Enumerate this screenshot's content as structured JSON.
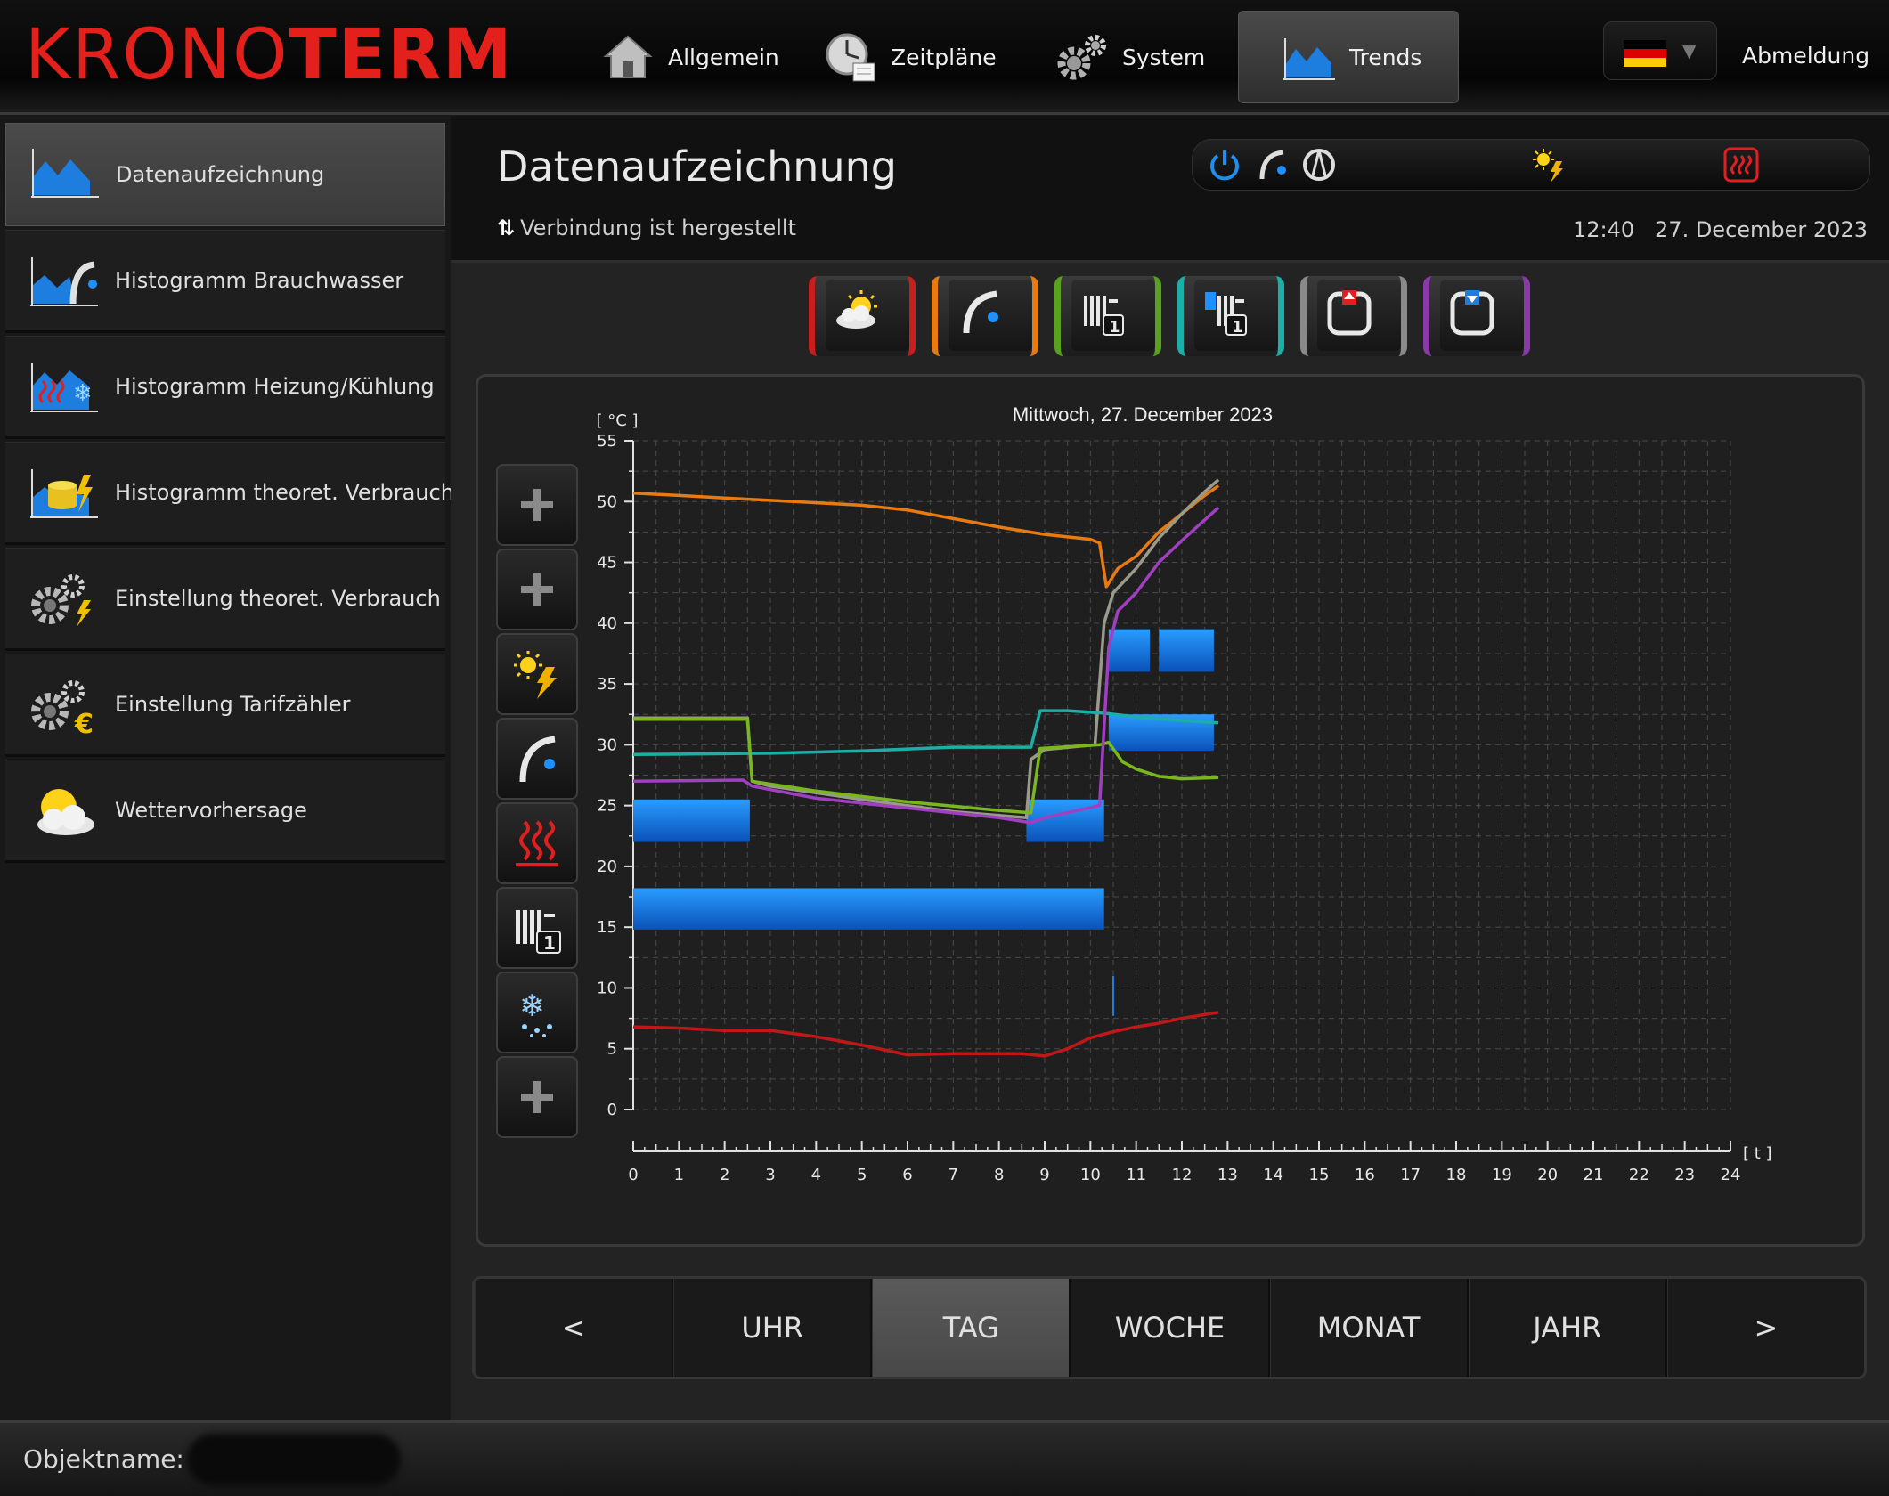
{
  "header": {
    "logo_thin": "KRONO",
    "logo_bold": "TERM",
    "nav": [
      {
        "label": "Allgemein",
        "icon": "home-icon"
      },
      {
        "label": "Zeitpläne",
        "icon": "clock-icon"
      },
      {
        "label": "System",
        "icon": "gears-icon"
      },
      {
        "label": "Trends",
        "icon": "trend-chart-icon"
      }
    ],
    "active_nav": "Trends",
    "language": "de",
    "logout_label": "Abmeldung"
  },
  "sidebar": {
    "items": [
      {
        "label": "Datenaufzeichnung",
        "icon": "area-chart-icon",
        "active": true
      },
      {
        "label": "Histogramm Brauchwasser",
        "icon": "dhw-histogram-icon"
      },
      {
        "label": "Histogramm Heizung/Kühlung",
        "icon": "heating-cooling-histogram-icon"
      },
      {
        "label": "Histogramm theoret. Verbrauch",
        "icon": "consumption-histogram-icon"
      },
      {
        "label": "Einstellung theoret. Verbrauch",
        "icon": "gear-lightning-icon"
      },
      {
        "label": "Einstellung Tarifzähler",
        "icon": "gear-euro-icon"
      },
      {
        "label": "Wettervorhersage",
        "icon": "weather-icon"
      }
    ]
  },
  "main": {
    "title": "Datenaufzeichnung",
    "connection_status": "Verbindung ist hergestellt",
    "time": "12:40",
    "date": "27. December 2023",
    "status_icons": [
      "power-icon",
      "tap-icon",
      "compressor-icon",
      "sun-lightning-icon",
      "heating-element-icon"
    ],
    "toolbar": [
      {
        "icon": "weather-icon",
        "color": "#c81e1e"
      },
      {
        "icon": "tap-icon",
        "color": "#e87a12"
      },
      {
        "icon": "radiator-1-icon",
        "color": "#5aa21e"
      },
      {
        "icon": "radiator-thermostat-1-icon",
        "color": "#1ab0a8"
      },
      {
        "icon": "storage-up-icon",
        "color": "#8a8a8a"
      },
      {
        "icon": "storage-down-icon",
        "color": "#8a3aa8"
      }
    ],
    "chart_side_buttons": [
      "plus-icon",
      "plus-icon",
      "sun-lightning-icon",
      "tap-icon",
      "heating-icon",
      "radiator-1-icon",
      "cooling-icon",
      "plus-icon"
    ],
    "periods": [
      {
        "label": "<"
      },
      {
        "label": "UHR"
      },
      {
        "label": "TAG",
        "active": true
      },
      {
        "label": "WOCHE"
      },
      {
        "label": "MONAT"
      },
      {
        "label": "JAHR"
      },
      {
        "label": ">"
      }
    ]
  },
  "footer": {
    "object_label": "Objektname:"
  },
  "chart_data": {
    "type": "line",
    "title": "Mittwoch, 27. December 2023",
    "ylabel": "[ °C ]",
    "xlabel": "[ t ]",
    "xlim": [
      0,
      24
    ],
    "ylim": [
      0,
      55
    ],
    "xticks": [
      0,
      1,
      2,
      3,
      4,
      5,
      6,
      7,
      8,
      9,
      10,
      11,
      12,
      13,
      14,
      15,
      16,
      17,
      18,
      19,
      20,
      21,
      22,
      23,
      24
    ],
    "yticks": [
      0,
      5,
      10,
      15,
      20,
      25,
      30,
      35,
      40,
      45,
      50,
      55
    ],
    "grid": true,
    "series": [
      {
        "color": "#e87a12",
        "points": [
          [
            0,
            50.7
          ],
          [
            1,
            50.5
          ],
          [
            2,
            50.3
          ],
          [
            3,
            50.1
          ],
          [
            4,
            49.9
          ],
          [
            5,
            49.7
          ],
          [
            6,
            49.3
          ],
          [
            7,
            48.6
          ],
          [
            8,
            47.9
          ],
          [
            9,
            47.3
          ],
          [
            10,
            46.9
          ],
          [
            10.2,
            46.6
          ],
          [
            10.35,
            43
          ],
          [
            10.6,
            44.5
          ],
          [
            11,
            45.5
          ],
          [
            11.5,
            47.5
          ],
          [
            12,
            49
          ],
          [
            12.5,
            50.5
          ],
          [
            12.8,
            51.3
          ]
        ]
      },
      {
        "color": "#9a9a8a",
        "points": [
          [
            0,
            32.2
          ],
          [
            2.5,
            32.2
          ],
          [
            2.6,
            27
          ],
          [
            3,
            26.6
          ],
          [
            5,
            25.5
          ],
          [
            7,
            24.5
          ],
          [
            8.6,
            24
          ],
          [
            8.7,
            28.8
          ],
          [
            9,
            29.6
          ],
          [
            10.1,
            30
          ],
          [
            10.3,
            40
          ],
          [
            10.5,
            42.5
          ],
          [
            11,
            44.5
          ],
          [
            11.5,
            47
          ],
          [
            12,
            49
          ],
          [
            12.5,
            50.8
          ],
          [
            12.8,
            51.8
          ]
        ]
      },
      {
        "color": "#1ab0a8",
        "points": [
          [
            0,
            29.2
          ],
          [
            3,
            29.3
          ],
          [
            5,
            29.5
          ],
          [
            7,
            29.8
          ],
          [
            8.7,
            29.8
          ],
          [
            8.9,
            32.8
          ],
          [
            9.5,
            32.8
          ],
          [
            10.3,
            32.6
          ],
          [
            11,
            32.3
          ],
          [
            12,
            32
          ],
          [
            12.8,
            31.8
          ]
        ]
      },
      {
        "color": "#7ab61e",
        "points": [
          [
            0,
            32.1
          ],
          [
            2.5,
            32.1
          ],
          [
            2.6,
            27
          ],
          [
            4,
            26.2
          ],
          [
            6,
            25.3
          ],
          [
            8,
            24.6
          ],
          [
            8.7,
            24.4
          ],
          [
            8.9,
            29.7
          ],
          [
            10.2,
            30
          ],
          [
            10.4,
            30.2
          ],
          [
            10.7,
            28.6
          ],
          [
            11,
            28
          ],
          [
            11.5,
            27.4
          ],
          [
            12,
            27.2
          ],
          [
            12.8,
            27.3
          ]
        ]
      },
      {
        "color": "#a040c0",
        "points": [
          [
            0,
            27
          ],
          [
            2.4,
            27.1
          ],
          [
            2.6,
            26.6
          ],
          [
            4,
            25.6
          ],
          [
            6,
            24.8
          ],
          [
            8,
            24
          ],
          [
            8.7,
            23.6
          ],
          [
            9,
            24
          ],
          [
            10.2,
            25
          ],
          [
            10.4,
            38
          ],
          [
            10.6,
            41
          ],
          [
            11,
            42.5
          ],
          [
            11.5,
            45
          ],
          [
            12,
            46.8
          ],
          [
            12.5,
            48.5
          ],
          [
            12.8,
            49.5
          ]
        ]
      },
      {
        "color": "#c01818",
        "points": [
          [
            0,
            6.8
          ],
          [
            1,
            6.7
          ],
          [
            2,
            6.5
          ],
          [
            3,
            6.5
          ],
          [
            4,
            6
          ],
          [
            5,
            5.3
          ],
          [
            6,
            4.5
          ],
          [
            7,
            4.6
          ],
          [
            8,
            4.6
          ],
          [
            8.5,
            4.6
          ],
          [
            9,
            4.4
          ],
          [
            9.5,
            5
          ],
          [
            10,
            5.9
          ],
          [
            10.5,
            6.4
          ],
          [
            11,
            6.8
          ],
          [
            11.5,
            7.1
          ],
          [
            12,
            7.5
          ],
          [
            12.8,
            8
          ]
        ]
      }
    ],
    "blocks": [
      {
        "x0": 0,
        "x1": 2.55,
        "y0": 22,
        "y1": 25.5
      },
      {
        "x0": 0,
        "x1": 10.3,
        "y0": 14.8,
        "y1": 18.2
      },
      {
        "x0": 8.6,
        "x1": 10.3,
        "y0": 22,
        "y1": 25.5
      },
      {
        "x0": 10.4,
        "x1": 11.3,
        "y0": 36,
        "y1": 39.5
      },
      {
        "x0": 11.5,
        "x1": 12.7,
        "y0": 36,
        "y1": 39.5
      },
      {
        "x0": 10.4,
        "x1": 12.7,
        "y0": 29.5,
        "y1": 32.5
      }
    ],
    "markers": [
      {
        "x": 10.5,
        "y0": 7.7,
        "y1": 11
      }
    ]
  }
}
